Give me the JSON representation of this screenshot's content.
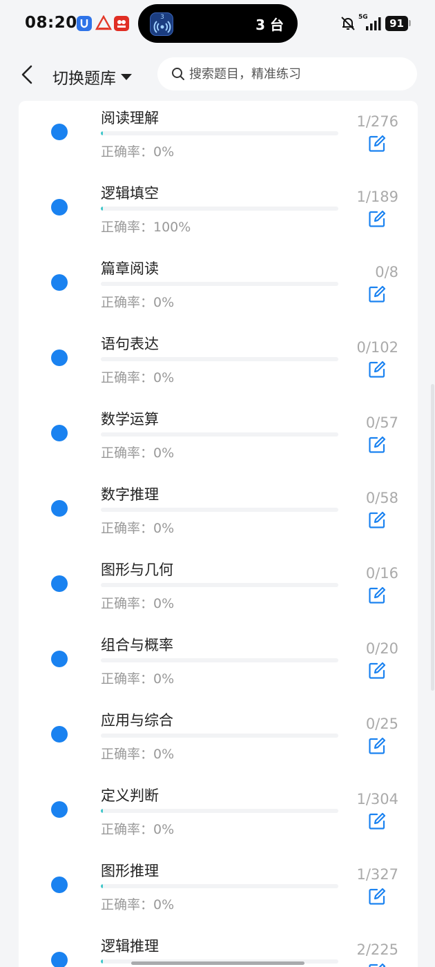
{
  "status_bar": {
    "time": "08:20",
    "island_badge": "3",
    "island_label": "3 台",
    "network": "5G",
    "battery": "91",
    "colors": {
      "accent": "#1a82f0",
      "progress": "#3ec6c9",
      "muted": "#999999"
    }
  },
  "header": {
    "title": "切换题库",
    "search_placeholder": "搜索题目，精准练习"
  },
  "icons": [
    "back-icon",
    "caret-down-icon",
    "search-icon",
    "edit-icon",
    "bell-off-icon",
    "signal-icon"
  ],
  "items": [
    {
      "title": "阅读理解",
      "accuracy": "正确率：0%",
      "count": "1/276",
      "progress": 0.0036
    },
    {
      "title": "逻辑填空",
      "accuracy": "正确率：100%",
      "count": "1/189",
      "progress": 0.0053
    },
    {
      "title": "篇章阅读",
      "accuracy": "正确率：0%",
      "count": "0/8",
      "progress": 0
    },
    {
      "title": "语句表达",
      "accuracy": "正确率：0%",
      "count": "0/102",
      "progress": 0
    },
    {
      "title": "数学运算",
      "accuracy": "正确率：0%",
      "count": "0/57",
      "progress": 0
    },
    {
      "title": "数字推理",
      "accuracy": "正确率：0%",
      "count": "0/58",
      "progress": 0
    },
    {
      "title": "图形与几何",
      "accuracy": "正确率：0%",
      "count": "0/16",
      "progress": 0
    },
    {
      "title": "组合与概率",
      "accuracy": "正确率：0%",
      "count": "0/20",
      "progress": 0
    },
    {
      "title": "应用与综合",
      "accuracy": "正确率：0%",
      "count": "0/25",
      "progress": 0
    },
    {
      "title": "定义判断",
      "accuracy": "正确率：0%",
      "count": "1/304",
      "progress": 0.0033
    },
    {
      "title": "图形推理",
      "accuracy": "正确率：0%",
      "count": "1/327",
      "progress": 0.0031
    },
    {
      "title": "逻辑推理",
      "accuracy": "",
      "count": "2/225",
      "progress": 0.0089
    }
  ]
}
